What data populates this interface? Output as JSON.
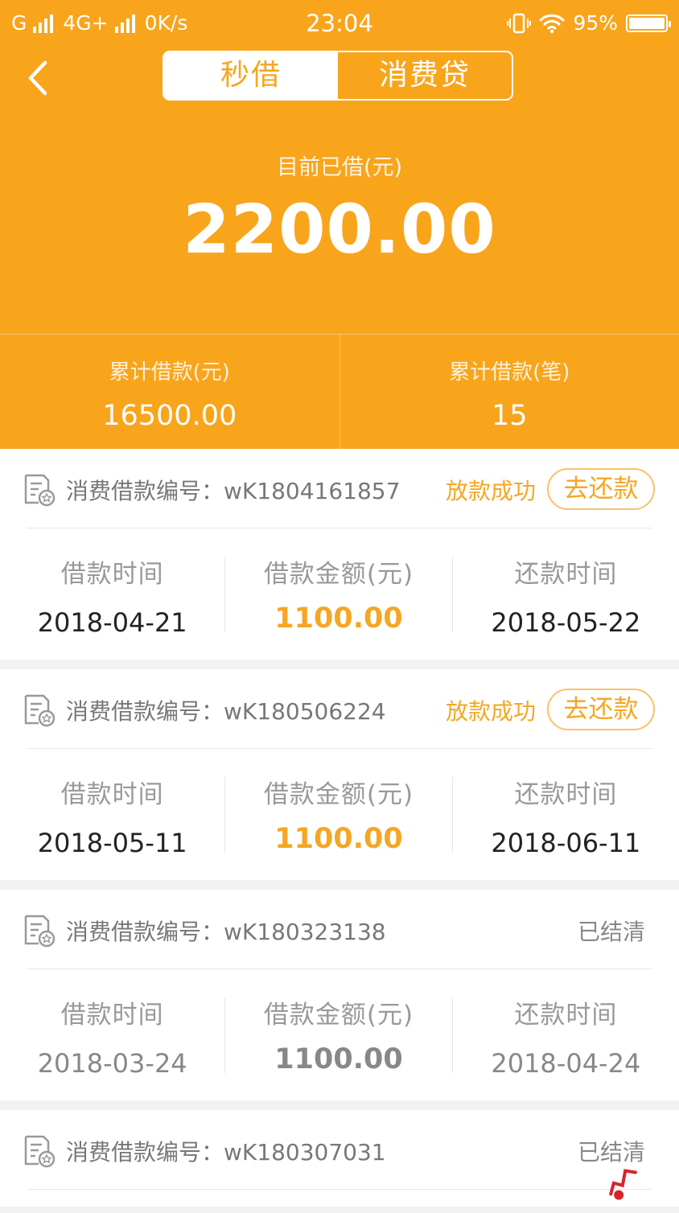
{
  "status_bar": {
    "carrier": "G",
    "network": "4G+",
    "speed": "0K/s",
    "time": "23:04",
    "battery": "95%"
  },
  "tabs": [
    {
      "label": "秒借",
      "active": true
    },
    {
      "label": "消费贷",
      "active": false
    }
  ],
  "current": {
    "label": "目前已借(元)",
    "amount": "2200.00"
  },
  "stats": [
    {
      "label": "累计借款(元)",
      "value": "16500.00"
    },
    {
      "label": "累计借款(笔)",
      "value": "15"
    }
  ],
  "column_labels": {
    "borrow_time": "借款时间",
    "amount": "借款金额(元)",
    "repay_time": "还款时间"
  },
  "loans": [
    {
      "number": "消费借款编号：wK1804161857",
      "status": "放款成功",
      "action": "去还款",
      "borrow_time": "2018-04-21",
      "amount": "1100.00",
      "repay_time": "2018-05-22"
    },
    {
      "number": "消费借款编号：wK180506224",
      "status": "放款成功",
      "action": "去还款",
      "borrow_time": "2018-05-11",
      "amount": "1100.00",
      "repay_time": "2018-06-11"
    },
    {
      "number": "消费借款编号：wK180323138",
      "status": "已结清",
      "borrow_time": "2018-03-24",
      "amount": "1100.00",
      "repay_time": "2018-04-24"
    },
    {
      "number": "消费借款编号：wK180307031",
      "status": "已结清"
    }
  ],
  "colors": {
    "brand": "#f8a51c",
    "accent_text": "#f5a623"
  }
}
